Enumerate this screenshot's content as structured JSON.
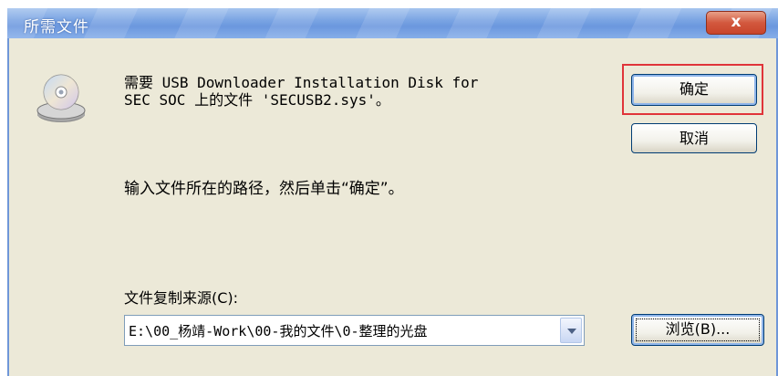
{
  "window": {
    "title": "所需文件",
    "close_label": "x"
  },
  "message": {
    "line1": "需要 USB Downloader Installation Disk for",
    "line2": "SEC SOC 上的文件 'SECUSB2.sys'。"
  },
  "instruction": "输入文件所在的路径，然后单击“确定”。",
  "source": {
    "label": "文件复制来源(C):",
    "value": "E:\\00_杨靖-Work\\00-我的文件\\0-整理的光盘"
  },
  "buttons": {
    "ok": "确定",
    "cancel": "取消",
    "browse": "浏览(B)..."
  },
  "colors": {
    "titlebar": "#7aa4e3",
    "highlight_border": "#e0343a",
    "dialog_bg": "#ece9d8"
  },
  "icons": {
    "disk": "cd-drive-icon",
    "dropdown": "chevron-down-icon"
  }
}
